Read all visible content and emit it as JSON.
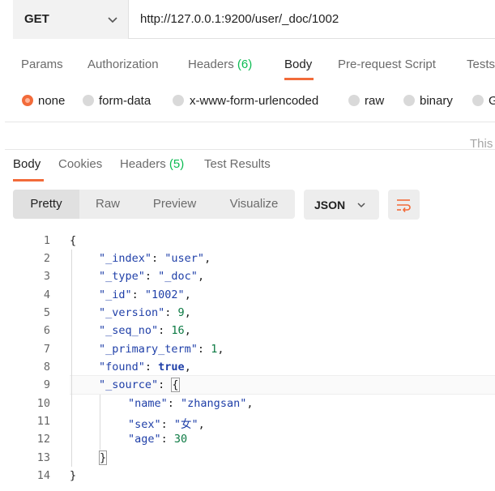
{
  "request": {
    "method": "GET",
    "url": "http://127.0.0.1:9200/user/_doc/1002"
  },
  "request_tabs": [
    {
      "label": "Params"
    },
    {
      "label": "Authorization"
    },
    {
      "label": "Headers",
      "count": "(6)"
    },
    {
      "label": "Body",
      "active": true
    },
    {
      "label": "Pre-request Script"
    },
    {
      "label": "Tests"
    }
  ],
  "body_options": [
    {
      "label": "none",
      "selected": true
    },
    {
      "label": "form-data"
    },
    {
      "label": "x-www-form-urlencoded"
    },
    {
      "label": "raw"
    },
    {
      "label": "binary"
    },
    {
      "label": "G"
    }
  ],
  "body_notice": "This",
  "response_tabs": [
    {
      "label": "Body",
      "active": true
    },
    {
      "label": "Cookies"
    },
    {
      "label": "Headers",
      "count": "(5)"
    },
    {
      "label": "Test Results"
    }
  ],
  "view_modes": [
    {
      "label": "Pretty",
      "active": true
    },
    {
      "label": "Raw"
    },
    {
      "label": "Preview"
    },
    {
      "label": "Visualize"
    }
  ],
  "language": "JSON",
  "icons": {
    "method_dropdown": "chevron-down-icon",
    "language_dropdown": "chevron-down-icon",
    "wrap": "wrap-lines-icon"
  },
  "colors": {
    "accent": "#f26b3a",
    "count": "#0cbb52",
    "json_key": "#1f3fa8",
    "json_number": "#0c7a43"
  },
  "code_lines": [
    {
      "n": "1",
      "text": "{"
    },
    {
      "n": "2",
      "key": "\"_index\"",
      "value": "\"user\"",
      "tail": ","
    },
    {
      "n": "3",
      "key": "\"_type\"",
      "value": "\"_doc\"",
      "tail": ","
    },
    {
      "n": "4",
      "key": "\"_id\"",
      "value": "\"1002\"",
      "tail": ","
    },
    {
      "n": "5",
      "key": "\"_version\"",
      "value": "9",
      "tail": ","
    },
    {
      "n": "6",
      "key": "\"_seq_no\"",
      "value": "16",
      "tail": ","
    },
    {
      "n": "7",
      "key": "\"_primary_term\"",
      "value": "1",
      "tail": ","
    },
    {
      "n": "8",
      "key": "\"found\"",
      "value": "true",
      "tail": ","
    },
    {
      "n": "9",
      "key": "\"_source\"",
      "value": "{",
      "tail": ""
    },
    {
      "n": "10",
      "key": "\"name\"",
      "value": "\"zhangsan\"",
      "tail": ","
    },
    {
      "n": "11",
      "key": "\"sex\"",
      "value": "\"女\"",
      "tail": ","
    },
    {
      "n": "12",
      "key": "\"age\"",
      "value": "30",
      "tail": ""
    },
    {
      "n": "13",
      "text": "}"
    },
    {
      "n": "14",
      "text": "}"
    }
  ]
}
